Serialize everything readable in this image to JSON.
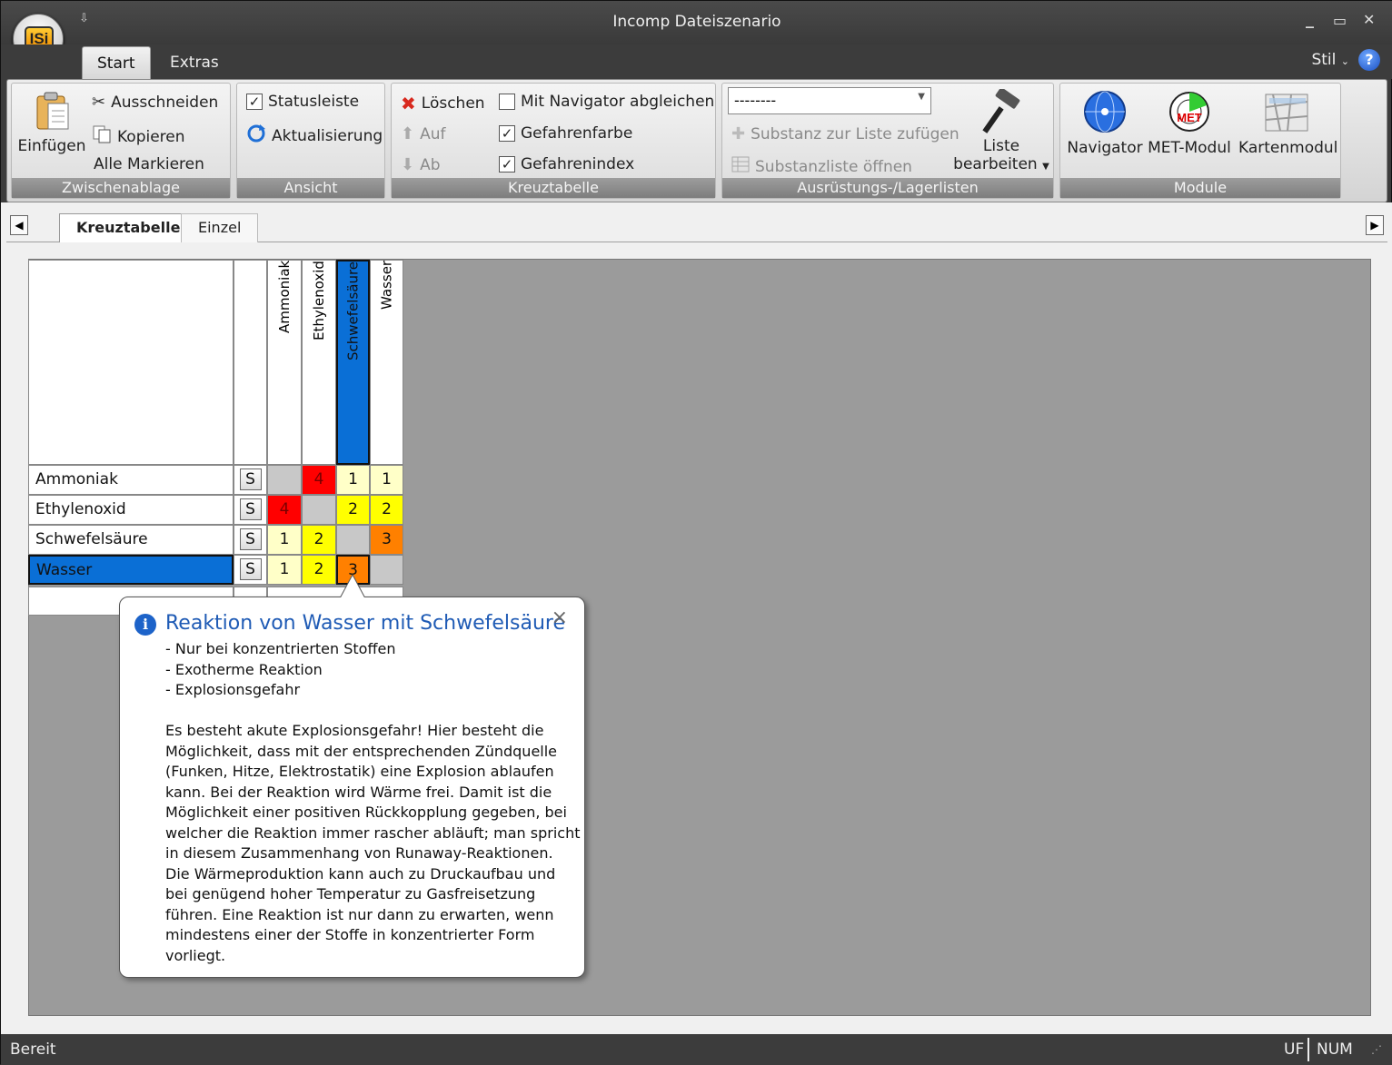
{
  "window": {
    "title": "Incomp Dateiszenario",
    "logo_text": "ISi",
    "qat_glyph": "⇩",
    "min": "_",
    "max": "▭",
    "close": "✕"
  },
  "ribbon_tabs": [
    {
      "label": "Start",
      "active": true
    },
    {
      "label": "Extras",
      "active": false
    }
  ],
  "style_menu": {
    "label": "Stil",
    "help": "?"
  },
  "ribbon": {
    "zwischenablage": {
      "caption": "Zwischenablage",
      "paste": "Einfügen",
      "cut": "Ausschneiden",
      "copy": "Kopieren",
      "select_all": "Alle Markieren"
    },
    "ansicht": {
      "caption": "Ansicht",
      "statusbar": "Statusleiste",
      "statusbar_checked": true,
      "refresh": "Aktualisierung"
    },
    "kreuztabelle": {
      "caption": "Kreuztabelle",
      "delete": "Löschen",
      "up": "Auf",
      "down": "Ab",
      "sync": "Mit Navigator abgleichen",
      "sync_checked": false,
      "hazard_color": "Gefahrenfarbe",
      "hazard_color_checked": true,
      "hazard_index": "Gefahrenindex",
      "hazard_index_checked": true
    },
    "listen": {
      "caption": "Ausrüstungs-/Lagerlisten",
      "combo_value": "--------",
      "add_substance": "Substanz zur Liste zufügen",
      "open_list": "Substanzliste öffnen",
      "edit_list_1": "Liste",
      "edit_list_2": "bearbeiten"
    },
    "module": {
      "caption": "Module",
      "navigator": "Navigator",
      "met": "MET-Modul",
      "map": "Kartenmodul"
    }
  },
  "doc_tabs": [
    {
      "label": "Kreuztabelle",
      "active": true
    },
    {
      "label": "Einzel",
      "active": false
    }
  ],
  "crosstable": {
    "s_label": "S",
    "columns": [
      "Ammoniak",
      "Ethylenoxid",
      "Schwefelsäure",
      "Wasser"
    ],
    "selected_column": 2,
    "rows": [
      {
        "name": "Ammoniak",
        "cells": [
          "",
          "4",
          "1",
          "1"
        ],
        "colors": [
          "#c8c8c8",
          "#ff0000",
          "#ffffc8",
          "#ffffc8"
        ]
      },
      {
        "name": "Ethylenoxid",
        "cells": [
          "4",
          "",
          "2",
          "2"
        ],
        "colors": [
          "#ff0000",
          "#c8c8c8",
          "#ffff00",
          "#ffff00"
        ]
      },
      {
        "name": "Schwefelsäure",
        "cells": [
          "1",
          "2",
          "",
          "3"
        ],
        "colors": [
          "#ffffc8",
          "#ffff00",
          "#c8c8c8",
          "#ff8000"
        ]
      },
      {
        "name": "Wasser",
        "cells": [
          "1",
          "2",
          "3",
          ""
        ],
        "colors": [
          "#ffffc8",
          "#ffff00",
          "#ff8000",
          "#c8c8c8"
        ]
      }
    ],
    "selected_row": 3
  },
  "tooltip": {
    "title": "Reaktion von Wasser mit Schwefelsäure",
    "close": "×",
    "bullets": [
      "- Nur bei konzentrierten Stoffen",
      "- Exotherme Reaktion",
      "- Explosionsgefahr"
    ],
    "lines": [
      "Es besteht akute Explosionsgefahr! Hier besteht die",
      "Möglichkeit, dass mit der entsprechenden Zündquelle",
      "(Funken, Hitze, Elektrostatik) eine Explosion ablaufen",
      "kann. Bei der Reaktion wird Wärme frei. Damit ist die",
      "Möglichkeit einer positiven Rückkopplung gegeben, bei",
      "welcher die Reaktion immer rascher abläuft; man spricht",
      "in diesem Zusammenhang von Runaway-Reaktionen.",
      "Die Wärmeproduktion kann auch zu Druckaufbau und",
      "bei genügend hoher Temperatur zu Gasfreisetzung",
      "führen. Eine Reaktion ist nur dann zu erwarten, wenn",
      "mindestens einer der Stoffe in konzentrierter Form",
      "vorliegt."
    ]
  },
  "status": {
    "text": "Bereit",
    "uf": "UF",
    "num": "NUM"
  },
  "colors": {
    "accent": "#0a6fd6",
    "selection": "#0a6fd6"
  }
}
